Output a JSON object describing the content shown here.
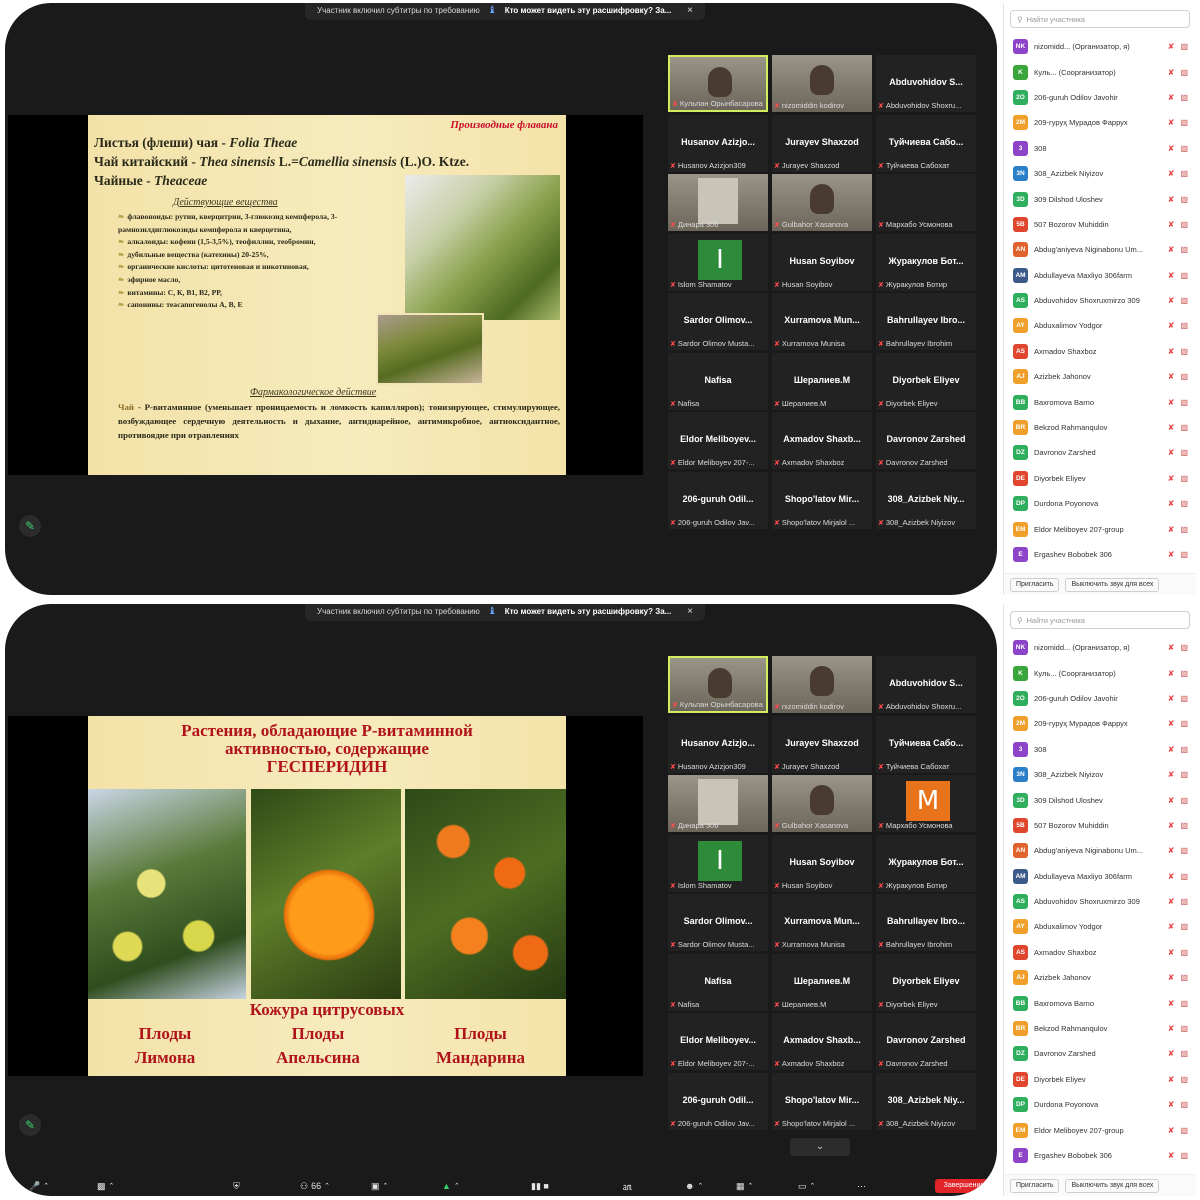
{
  "banner": {
    "subtitles_notice": "Участник включил субтитры по требованию",
    "transcript_question": "Кто может видеть эту расшифровку? За...",
    "close": "×"
  },
  "slide1": {
    "red_heading": "Производные флавана",
    "title_line1": "Листья (флеши) чая - ",
    "title_line1_latin": "Folia Theae",
    "title_line2": "Чай китайский - ",
    "title_line2_latin": "Thea sinensis",
    "title_line2_rest": " L.=",
    "title_line2_latin2": "Camellia sinensis",
    "title_line2_tail": " (L.)O. Ktze.",
    "title_line3": "Чайные - ",
    "title_line3_latin": "Theaceae",
    "section_active": "Действующие вещества",
    "items": [
      "флавоноиды: рутин, кверцитрин, 3-глюкозид кемпферола, 3-рамнозилдиглюкозиды кемпферола и кверцетина,",
      "алкалоиды: кофеин (1,5-3,5%), теофиллин, теобромин,",
      "дубильные вещества (катехины) 20-25%,",
      "органические кислоты: цитотеновая и никотиновая,",
      "эфирное масло,",
      "витамины: С, К, В1, В2, РР,",
      "сапонины: теасапогенолы А, В, Е"
    ],
    "section_pharm": "Фармакологическое действие",
    "pharm_lead": "Чай",
    "pharm_text": " - Р-витаминное (уменьшает проницаемость и ломкость капилляров); тонизирующее, стимулирующее, возбуждающее сердечную деятельность и дыхание, антидиарейное, антимикробное, антиоксидантное, противоядие при отравлениях"
  },
  "slide2": {
    "title_line1": "Растения, обладающие Р-витаминной",
    "title_line2": "активностью, содержащие",
    "title_line3": "ГЕСПЕРИДИН",
    "subtitle": "Кожура цитрусовых",
    "fruits": [
      {
        "line1": "Плоды",
        "line2": "Лимона"
      },
      {
        "line1": "Плоды",
        "line2": "Апельсина"
      },
      {
        "line1": "Плоды",
        "line2": "Мандарина"
      }
    ]
  },
  "tiles_frame1": [
    {
      "big": "",
      "sub": "Кульпан Орынбасарова",
      "video": true
    },
    {
      "big": "",
      "sub": "nizomiddin kodirov",
      "video": true
    },
    {
      "big": "Abduvohidov S...",
      "sub": "Abduvohidov Shoxru..."
    },
    {
      "big": "Husanov Azizjo...",
      "sub": "Husanov Azizjon309"
    },
    {
      "big": "Jurayev Shaxzod",
      "sub": "Jurayev Shaxzod"
    },
    {
      "big": "Туйчиева Сабо...",
      "sub": "Туйчиева Сабохат"
    },
    {
      "big": "",
      "sub": "Динара 306",
      "video": true
    },
    {
      "big": "",
      "sub": "Gulbahor Xasanova",
      "video": true
    },
    {
      "big": "",
      "sub": "Мархабо Усмонова"
    },
    {
      "big": "I",
      "sub": "Islom Shamatov",
      "avatar": "#2e8b3a"
    },
    {
      "big": "Husan Soyibov",
      "sub": "Husan Soyibov"
    },
    {
      "big": "Журакулов Бот...",
      "sub": "Журакулов Ботир"
    },
    {
      "big": "Sardor Olimov...",
      "sub": "Sardor Olimov Musta..."
    },
    {
      "big": "Xurramova Mun...",
      "sub": "Xurramova Munisa"
    },
    {
      "big": "Bahrullayev Ibro...",
      "sub": "Bahrullayev Ibrohim"
    },
    {
      "big": "Nafisa",
      "sub": "Nafisa"
    },
    {
      "big": "Шералиев.М",
      "sub": "Шералиев.М"
    },
    {
      "big": "Diyorbek Eliyev",
      "sub": "Diyorbek Eliyev"
    },
    {
      "big": "Eldor Meliboyev...",
      "sub": "Eldor Meliboyev 207-..."
    },
    {
      "big": "Axmadov Shaxb...",
      "sub": "Axmadov Shaxboz"
    },
    {
      "big": "Davronov Zarshed",
      "sub": "Davronov Zarshed"
    },
    {
      "big": "206-guruh Odil...",
      "sub": "206-guruh Odilov Jav..."
    },
    {
      "big": "Shopo'latov Mir...",
      "sub": "Shopo'latov Mirjalol ..."
    },
    {
      "big": "308_Azizbek Niy...",
      "sub": "308_Azizbek Niyizov"
    }
  ],
  "tiles_frame2_m_avatar": "M",
  "participants_search_placeholder": "Найти участника",
  "participants": [
    {
      "badge": "NK",
      "color": "#8e44c9",
      "name": "nizomidd... (Организатор, я)"
    },
    {
      "badge": "K",
      "color": "#3aa53a",
      "name": "Куль... (Соорганизатор)"
    },
    {
      "badge": "2O",
      "color": "#2fae5e",
      "name": "206-guruh Odilov Javohir"
    },
    {
      "badge": "2M",
      "color": "#f0a02a",
      "name": "209-гуруҳ Мурадов Фаррух"
    },
    {
      "badge": "3",
      "color": "#8e44c9",
      "name": "308"
    },
    {
      "badge": "3N",
      "color": "#2b7fc9",
      "name": "308_Azizbek Niyizov"
    },
    {
      "badge": "3D",
      "color": "#2fae5e",
      "name": "309 Dilshod Uloshev"
    },
    {
      "badge": "5B",
      "color": "#e0452d",
      "name": "507 Bozorov Muhiddin"
    },
    {
      "badge": "AN",
      "color": "#e0622d",
      "name": "Abdug'aniyeva Niginabonu Um..."
    },
    {
      "badge": "AM",
      "color": "#3b5a8a",
      "name": "Abdullayeva Maxliyo 306farm"
    },
    {
      "badge": "AS",
      "color": "#2fae5e",
      "name": "Abduvohidov Shoxruxmirzo 309"
    },
    {
      "badge": "AY",
      "color": "#f0a02a",
      "name": "Abduxalimov Yodgor"
    },
    {
      "badge": "AS",
      "color": "#e0452d",
      "name": "Axmadov Shaxboz"
    },
    {
      "badge": "AJ",
      "color": "#f0a02a",
      "name": "Azizbek Jahonov"
    },
    {
      "badge": "BB",
      "color": "#2fae5e",
      "name": "Baxromova Barno"
    },
    {
      "badge": "BR",
      "color": "#f0a02a",
      "name": "Bekzod Rahmanqulov"
    },
    {
      "badge": "DZ",
      "color": "#2fae5e",
      "name": "Davronov Zarshed"
    },
    {
      "badge": "DE",
      "color": "#e0452d",
      "name": "Diyorbek Eliyev"
    },
    {
      "badge": "DP",
      "color": "#2fae5e",
      "name": "Durdona Poyonova"
    },
    {
      "badge": "EM",
      "color": "#f0a02a",
      "name": "Eldor Meliboyev 207-group"
    },
    {
      "badge": "E",
      "color": "#8e44c9",
      "name": "Ergashev Bobobek 306"
    }
  ],
  "footer": {
    "invite": "Пригласить",
    "mute_all": "Выключить звук для всех"
  },
  "toolbar": {
    "participants_count": "66",
    "end": "Завершение"
  }
}
